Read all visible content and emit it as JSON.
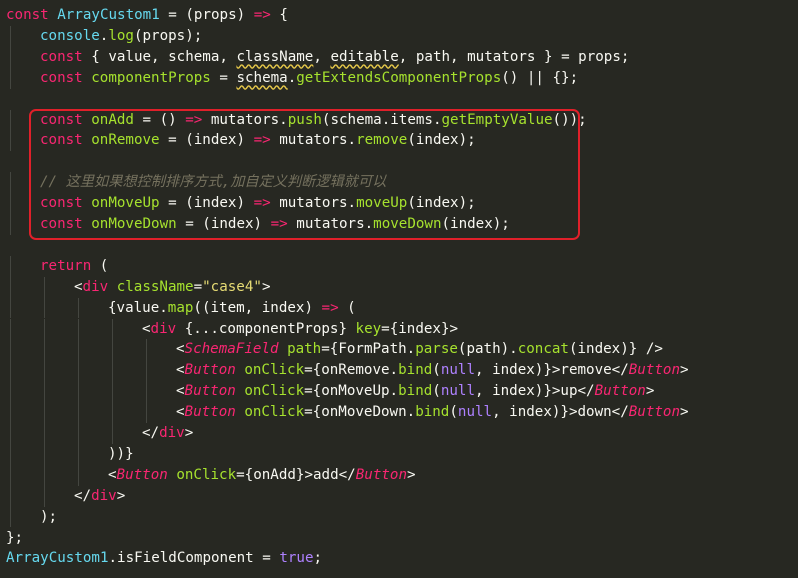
{
  "colors": {
    "background": "#272822",
    "keyword": "#f92672",
    "function": "#a6e22e",
    "type": "#66d9ef",
    "string": "#e6db74",
    "constant": "#ae81ff",
    "comment": "#75715e",
    "text": "#f8f8f2",
    "highlight_border": "#e0202a"
  },
  "lines": [
    [
      [
        "const ",
        "kw"
      ],
      [
        "ArrayCustom1",
        "type"
      ],
      [
        " = (props) ",
        "plain"
      ],
      [
        "=>",
        "kw"
      ],
      [
        " {",
        "plain"
      ]
    ],
    [
      [
        "console",
        "type"
      ],
      [
        ".",
        "plain"
      ],
      [
        "log",
        "fn"
      ],
      [
        "(props);",
        "plain"
      ]
    ],
    [
      [
        "const ",
        "kw"
      ],
      [
        "{ value, schema, ",
        "plain"
      ],
      [
        "className",
        "warn"
      ],
      [
        ", ",
        "plain"
      ],
      [
        "editable",
        "warn"
      ],
      [
        ", path, mutators } = props;",
        "plain"
      ]
    ],
    [
      [
        "const ",
        "kw"
      ],
      [
        "componentProps",
        "fn"
      ],
      [
        " = ",
        "plain"
      ],
      [
        "schema",
        "warn"
      ],
      [
        ".",
        "plain"
      ],
      [
        "getExtendsComponentProps",
        "fn"
      ],
      [
        "() || {};",
        "plain"
      ]
    ],
    [],
    [
      [
        "const ",
        "kw"
      ],
      [
        "onAdd",
        "fn"
      ],
      [
        " = () ",
        "plain"
      ],
      [
        "=>",
        "kw"
      ],
      [
        " mutators.",
        "plain"
      ],
      [
        "push",
        "fn"
      ],
      [
        "(schema.items.",
        "plain"
      ],
      [
        "getEmptyValue",
        "fn"
      ],
      [
        "());",
        "plain"
      ]
    ],
    [
      [
        "const ",
        "kw"
      ],
      [
        "onRemove",
        "fn"
      ],
      [
        " = (index) ",
        "plain"
      ],
      [
        "=>",
        "kw"
      ],
      [
        " mutators.",
        "plain"
      ],
      [
        "remove",
        "fn"
      ],
      [
        "(index);",
        "plain"
      ]
    ],
    [],
    [
      [
        "// 这里如果想控制排序方式,加自定义判断逻辑就可以",
        "cmt"
      ]
    ],
    [
      [
        "const ",
        "kw"
      ],
      [
        "onMoveUp",
        "fn"
      ],
      [
        " = (index) ",
        "plain"
      ],
      [
        "=>",
        "kw"
      ],
      [
        " mutators.",
        "plain"
      ],
      [
        "moveUp",
        "fn"
      ],
      [
        "(index);",
        "plain"
      ]
    ],
    [
      [
        "const ",
        "kw"
      ],
      [
        "onMoveDown",
        "fn"
      ],
      [
        " = (index) ",
        "plain"
      ],
      [
        "=>",
        "kw"
      ],
      [
        " mutators.",
        "plain"
      ],
      [
        "moveDown",
        "fn"
      ],
      [
        "(index);",
        "plain"
      ]
    ],
    [],
    [
      [
        "return",
        "kw"
      ],
      [
        " (",
        "plain"
      ]
    ],
    [
      [
        "<",
        "plain"
      ],
      [
        "div",
        "tag"
      ],
      [
        " ",
        "plain"
      ],
      [
        "className",
        "attr"
      ],
      [
        "=",
        "plain"
      ],
      [
        "\"case4\"",
        "str"
      ],
      [
        ">",
        "plain"
      ]
    ],
    [
      [
        "{value.",
        "plain"
      ],
      [
        "map",
        "fn"
      ],
      [
        "((item, index) ",
        "plain"
      ],
      [
        "=>",
        "kw"
      ],
      [
        " (",
        "plain"
      ]
    ],
    [
      [
        "<",
        "plain"
      ],
      [
        "div",
        "tag"
      ],
      [
        " {...componentProps} ",
        "plain"
      ],
      [
        "key",
        "attr"
      ],
      [
        "={index}>",
        "plain"
      ]
    ],
    [
      [
        "<",
        "plain"
      ],
      [
        "SchemaField",
        "comp"
      ],
      [
        " ",
        "plain"
      ],
      [
        "path",
        "attr"
      ],
      [
        "={FormPath.",
        "plain"
      ],
      [
        "parse",
        "fn"
      ],
      [
        "(path).",
        "plain"
      ],
      [
        "concat",
        "fn"
      ],
      [
        "(index)} />",
        "plain"
      ]
    ],
    [
      [
        "<",
        "plain"
      ],
      [
        "Button",
        "comp"
      ],
      [
        " ",
        "plain"
      ],
      [
        "onClick",
        "attr"
      ],
      [
        "={onRemove.",
        "plain"
      ],
      [
        "bind",
        "fn"
      ],
      [
        "(",
        "plain"
      ],
      [
        "null",
        "const"
      ],
      [
        ", index)}>remove</",
        "plain"
      ],
      [
        "Button",
        "comp"
      ],
      [
        ">",
        "plain"
      ]
    ],
    [
      [
        "<",
        "plain"
      ],
      [
        "Button",
        "comp"
      ],
      [
        " ",
        "plain"
      ],
      [
        "onClick",
        "attr"
      ],
      [
        "={onMoveUp.",
        "plain"
      ],
      [
        "bind",
        "fn"
      ],
      [
        "(",
        "plain"
      ],
      [
        "null",
        "const"
      ],
      [
        ", index)}>up</",
        "plain"
      ],
      [
        "Button",
        "comp"
      ],
      [
        ">",
        "plain"
      ]
    ],
    [
      [
        "<",
        "plain"
      ],
      [
        "Button",
        "comp"
      ],
      [
        " ",
        "plain"
      ],
      [
        "onClick",
        "attr"
      ],
      [
        "={onMoveDown.",
        "plain"
      ],
      [
        "bind",
        "fn"
      ],
      [
        "(",
        "plain"
      ],
      [
        "null",
        "const"
      ],
      [
        ", index)}>down</",
        "plain"
      ],
      [
        "Button",
        "comp"
      ],
      [
        ">",
        "plain"
      ]
    ],
    [
      [
        "</",
        "plain"
      ],
      [
        "div",
        "tag"
      ],
      [
        ">",
        "plain"
      ]
    ],
    [
      [
        "))}",
        "plain"
      ]
    ],
    [
      [
        "<",
        "plain"
      ],
      [
        "Button",
        "comp"
      ],
      [
        " ",
        "plain"
      ],
      [
        "onClick",
        "attr"
      ],
      [
        "={onAdd}>add</",
        "plain"
      ],
      [
        "Button",
        "comp"
      ],
      [
        ">",
        "plain"
      ]
    ],
    [
      [
        "</",
        "plain"
      ],
      [
        "div",
        "tag"
      ],
      [
        ">",
        "plain"
      ]
    ],
    [
      [
        ");",
        "plain"
      ]
    ],
    [
      [
        "};",
        "plain"
      ]
    ],
    [
      [
        "ArrayCustom1",
        "type"
      ],
      [
        ".isFieldComponent = ",
        "plain"
      ],
      [
        "true",
        "const"
      ],
      [
        ";",
        "plain"
      ]
    ]
  ]
}
